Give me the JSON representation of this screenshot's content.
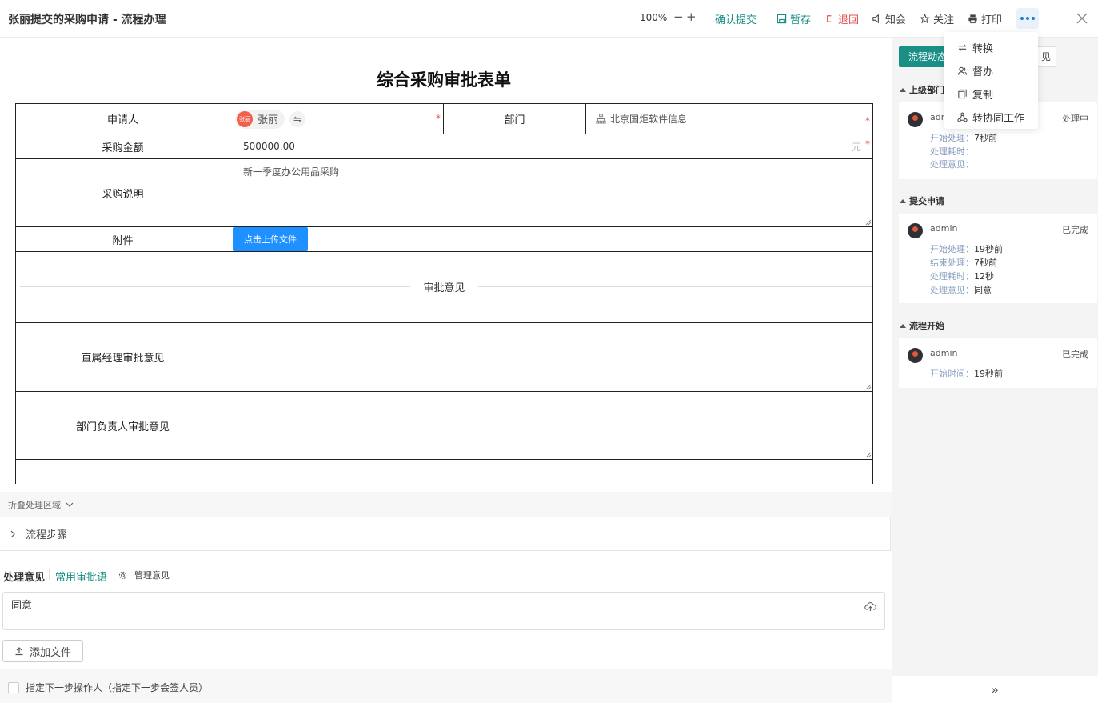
{
  "header": {
    "title": "张丽提交的采购申请 - 流程办理",
    "zoom": "100%",
    "zoom_out": "−",
    "zoom_in": "+",
    "confirm": "确认提交",
    "save": "暂存",
    "return": "退回",
    "notify": "知会",
    "follow": "关注",
    "print": "打印"
  },
  "dropdown": {
    "items": [
      "转换",
      "督办",
      "复制",
      "转协同工作"
    ]
  },
  "form": {
    "title": "综合采购审批表单",
    "applicant_label": "申请人",
    "applicant_avatar": "张丽",
    "applicant_name": "张丽",
    "dept_label": "部门",
    "dept_value": "北京国炬软件信息",
    "amount_label": "采购金额",
    "amount_value": "500000.00",
    "amount_unit": "元",
    "desc_label": "采购说明",
    "desc_value": "新一季度办公用品采购",
    "attach_label": "附件",
    "upload_button": "点击上传文件",
    "approval_divider": "审批意见",
    "manager_label": "直属经理审批意见",
    "dept_head_label": "部门负责人审批意见",
    "required_mark": "*"
  },
  "bottom": {
    "fold_label": "折叠处理区域",
    "steps_label": "流程步骤",
    "opinion_label": "处理意见",
    "common_phrases": "常用审批语",
    "manage_opinion": "管理意见",
    "opinion_value": "同意",
    "add_file": "添加文件",
    "next_operator": "指定下一步操作人（指定下一步会签人员）"
  },
  "right_panel": {
    "tab_active": "流程动态",
    "tab_other": "见",
    "sections": [
      {
        "title": "上级部门",
        "user": "adm",
        "status": "处理中",
        "rows": [
          {
            "k": "开始处理：",
            "v": "7秒前"
          },
          {
            "k": "处理耗时：",
            "v": ""
          },
          {
            "k": "处理意见：",
            "v": ""
          }
        ]
      },
      {
        "title": "提交申请",
        "user": "admin",
        "status": "已完成",
        "rows": [
          {
            "k": "开始处理：",
            "v": "19秒前"
          },
          {
            "k": "结束处理：",
            "v": "7秒前"
          },
          {
            "k": "处理耗时：",
            "v": "12秒"
          },
          {
            "k": "处理意见：",
            "v": "同意"
          }
        ]
      },
      {
        "title": "流程开始",
        "user": "admin",
        "status": "已完成",
        "rows": [
          {
            "k": "开始时间：",
            "v": "19秒前"
          }
        ]
      }
    ],
    "expand": "»"
  },
  "colors": {
    "teal": "#1a8f86",
    "red": "#e0534f",
    "blue": "#1e90ff"
  }
}
